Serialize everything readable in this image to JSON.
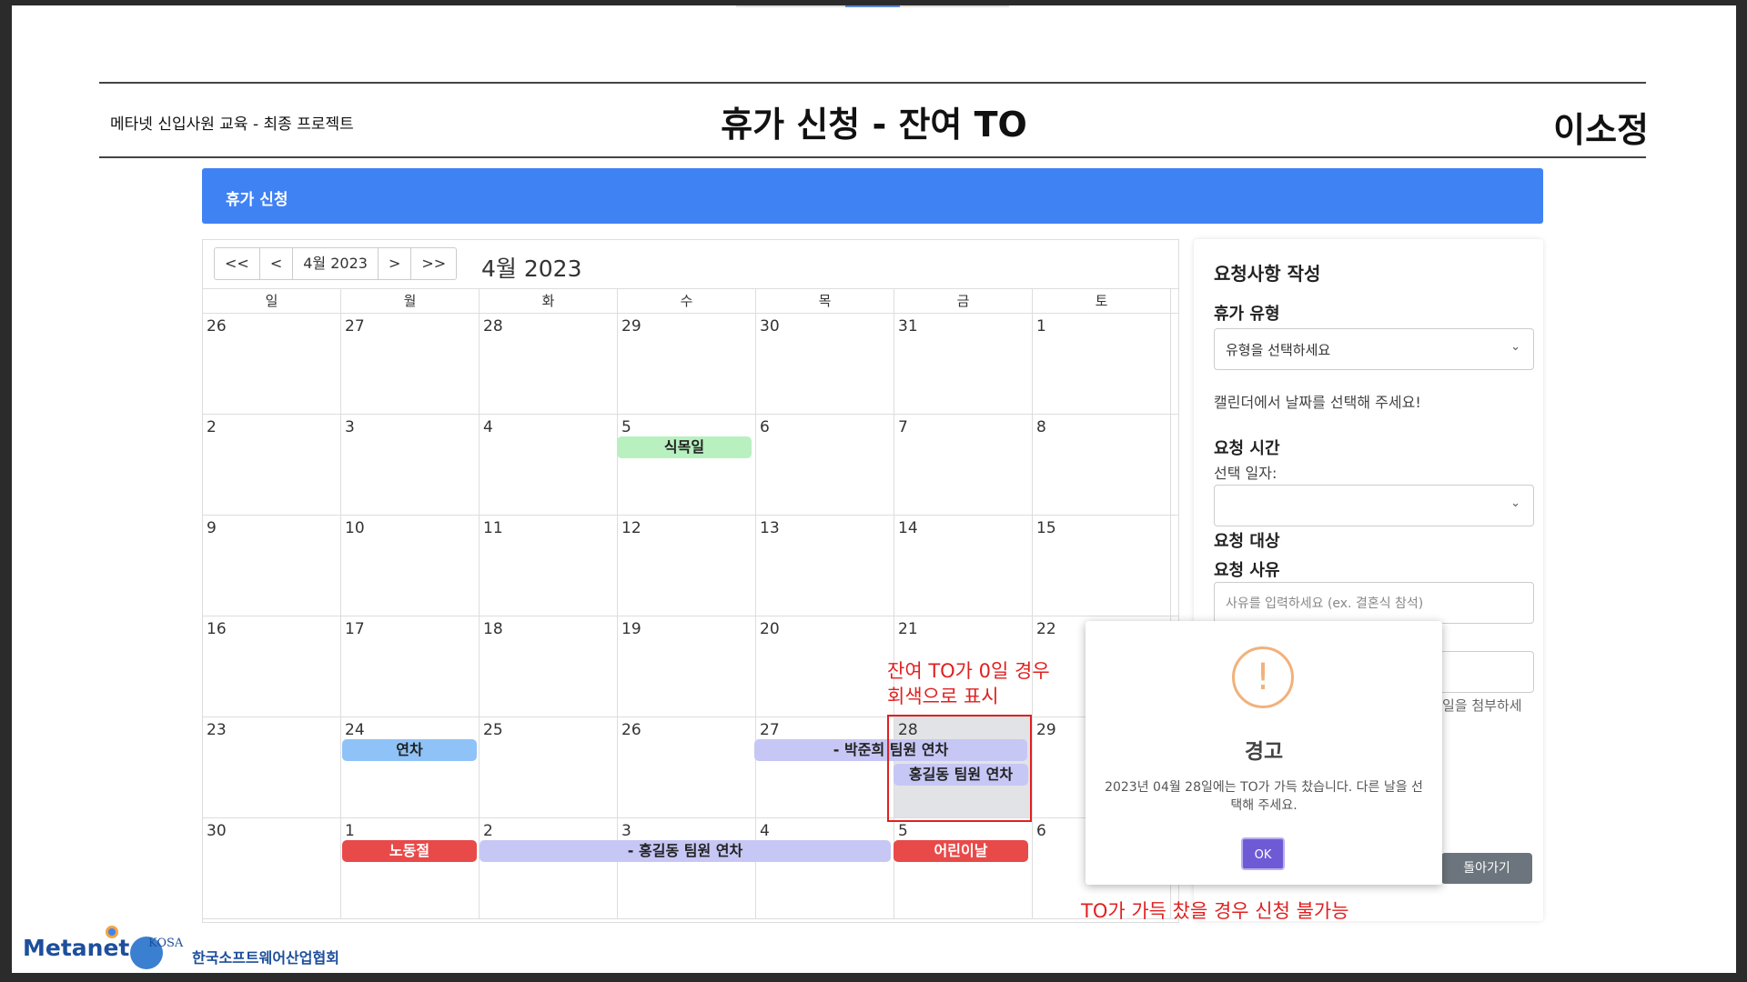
{
  "header": {
    "left": "메타넷 신입사원 교육 - 최종 프로젝트",
    "title": "휴가 신청 - 잔여 TO",
    "right": "이소정"
  },
  "banner": {
    "label": "휴가 신청"
  },
  "calendar": {
    "nav": {
      "first": "<<",
      "prev": "<",
      "current": "4월 2023",
      "next": ">",
      "last": ">>"
    },
    "title": "4월 2023",
    "weekdays": [
      "일",
      "월",
      "화",
      "수",
      "목",
      "금",
      "토"
    ],
    "weeks": [
      [
        "26",
        "27",
        "28",
        "29",
        "30",
        "31",
        "1"
      ],
      [
        "2",
        "3",
        "4",
        "5",
        "6",
        "7",
        "8"
      ],
      [
        "9",
        "10",
        "11",
        "12",
        "13",
        "14",
        "15"
      ],
      [
        "16",
        "17",
        "18",
        "19",
        "20",
        "21",
        "22"
      ],
      [
        "23",
        "24",
        "25",
        "26",
        "27",
        "28",
        "29"
      ],
      [
        "30",
        "1",
        "2",
        "3",
        "4",
        "5",
        "6"
      ]
    ],
    "events": {
      "arbor_day": "식목일",
      "annual_leave": "연차",
      "park_leave": "- 박준희 팀원 연차",
      "hong_leave_28": "홍길동 팀원 연차",
      "labor_day": "노동절",
      "hong_leave_range": "- 홍길동 팀원 연차",
      "childrens_day": "어린이날"
    }
  },
  "panel": {
    "heading": "요청사항 작성",
    "leave_type_label": "휴가 유형",
    "leave_type_value": "유형을 선택하세요",
    "calendar_hint": "캘린더에서 날짜를 선택해 주세요!",
    "request_time_label": "요청 시간",
    "selected_date_label": "선택 일자:",
    "target_label": "요청 대상",
    "reason_label": "요청 사유",
    "reason_placeholder": "사유를 입력하세요 (ex. 결혼식 참석)",
    "attach_hint": "일을 첨부하세",
    "back_button": "돌아가기"
  },
  "modal": {
    "icon": "!",
    "title": "경고",
    "message": "2023년 04월 28일에는 TO가 가득 찼습니다. 다른 날을 선택해 주세요.",
    "ok": "OK"
  },
  "annotations": {
    "grey_note_line1": "잔여 TO가 0일 경우",
    "grey_note_line2": "회색으로 표시",
    "full_note": "TO가 가득 찼을 경우 신청 불가능"
  },
  "footer": {
    "metanet": "Metanet",
    "kosa": "KOSA",
    "kosa_name": "한국소프트웨어산업협회"
  },
  "colors": {
    "banner": "#3f82f4",
    "grey_day": "#e2e3e6",
    "red_event": "#e84a4a",
    "annotation_red": "#e02020",
    "ok_button": "#6f5ad6"
  }
}
